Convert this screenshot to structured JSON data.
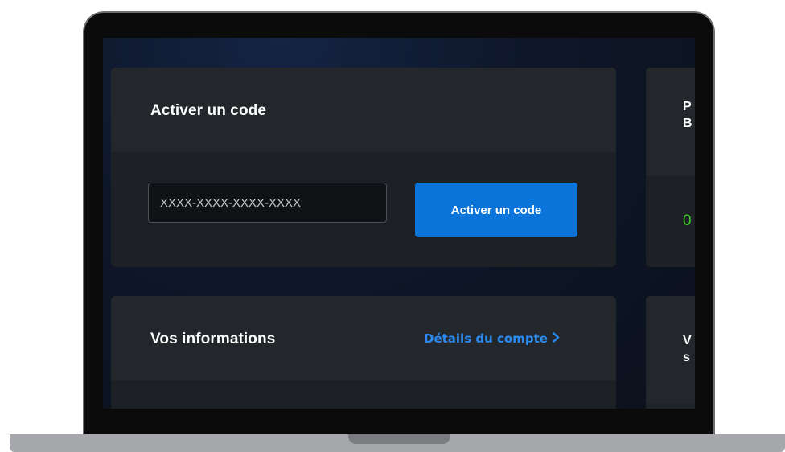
{
  "activate_card": {
    "title": "Activer un code",
    "input_placeholder": "XXXX-XXXX-XXXX-XXXX",
    "button_label": "Activer un code"
  },
  "info_card": {
    "title": "Vos informations",
    "details_link": "Détails du compte"
  },
  "right_cards": {
    "top_title_fragment": "P\nB",
    "top_value_fragment": "0",
    "bottom_title_fragment": "V\ns"
  },
  "icons": {
    "chevron": "chevron-right-icon"
  },
  "colors": {
    "accent": "#0a74da",
    "link": "#2b8bf0",
    "positive": "#3ecb2b",
    "card": "#202327"
  }
}
